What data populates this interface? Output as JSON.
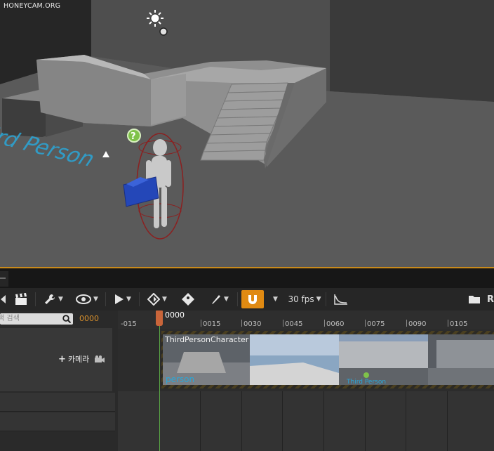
{
  "watermark": "HONEYCAM.ORG",
  "viewport": {
    "floor_text": "Third Person"
  },
  "toolbar": {
    "fps_label": "30 fps",
    "right_letter": "R"
  },
  "outliner": {
    "search_placeholder": "택 검색",
    "current_frame": "0000",
    "camera_button_label": "카메라"
  },
  "timeline": {
    "playhead_frame": "0000",
    "ticks": [
      "-015",
      "0015",
      "0030",
      "0045",
      "0060",
      "0075",
      "0090",
      "0105"
    ],
    "shot_label": "ThirdPersonCharacter"
  },
  "colors": {
    "accent": "#e08a12",
    "timecode": "#d8902c",
    "playhead": "#c9653a",
    "floor_text": "#2aa7d8"
  }
}
